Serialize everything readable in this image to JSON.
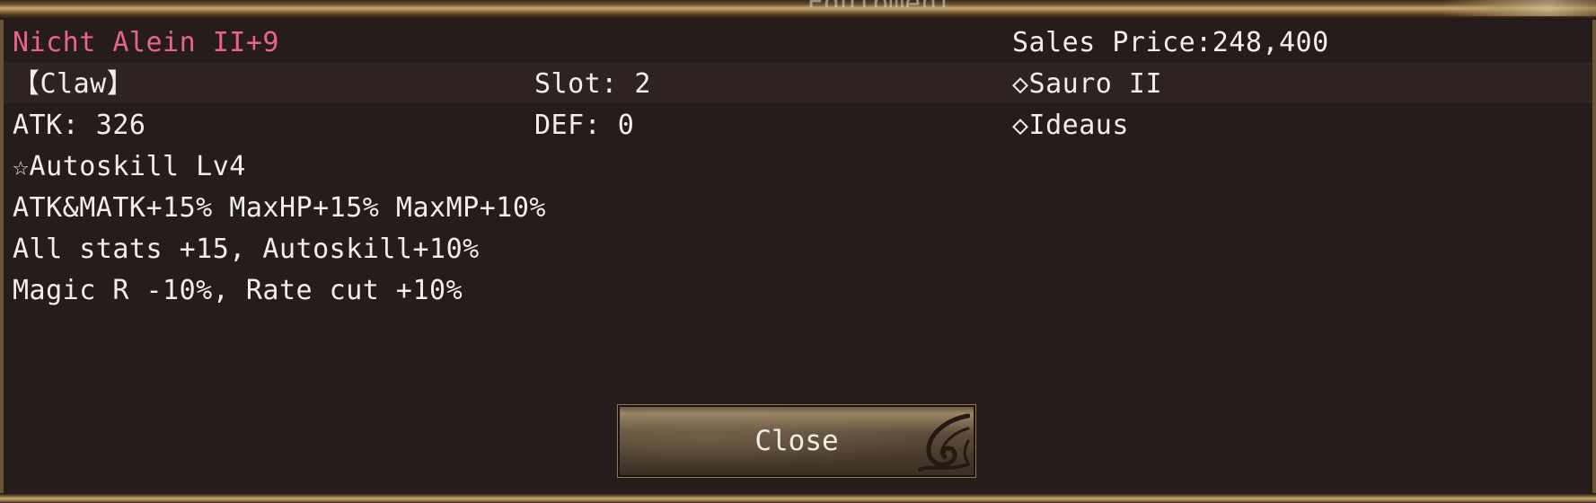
{
  "window": {
    "title": "Equipment"
  },
  "item": {
    "name": "Nicht Alein II+9",
    "type": "【Claw】",
    "slot": "Slot: 2",
    "atk": "ATK: 326",
    "def": "DEF: 0",
    "autoskill": "☆Autoskill Lv4",
    "effects": [
      "ATK&MATK+15% MaxHP+15% MaxMP+10%",
      "All stats +15, Autoskill+10%",
      "Magic R -10%, Rate cut +10%"
    ],
    "sales_price": "Sales Price:248,400",
    "cards": [
      "◇Sauro II",
      "◇Ideaus"
    ]
  },
  "buttons": {
    "close_label": "Close"
  },
  "colors": {
    "item_name": "#e9648a",
    "text": "#f2efe9",
    "panel_bg": "#261c1b"
  }
}
